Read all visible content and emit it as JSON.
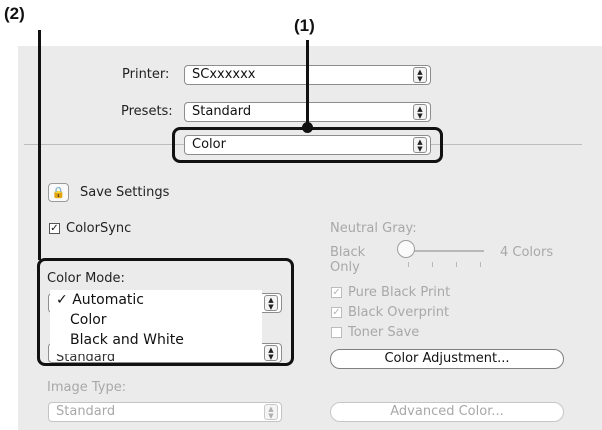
{
  "callouts": {
    "one": "(1)",
    "two": "(2)"
  },
  "printer": {
    "label": "Printer:",
    "value": "SCxxxxxx"
  },
  "presets": {
    "label": "Presets:",
    "value": "Standard"
  },
  "panel_select": {
    "value": "Color"
  },
  "save_settings": {
    "label": "Save Settings"
  },
  "colorsync": {
    "label": "ColorSync",
    "checked": true
  },
  "color_mode": {
    "label": "Color Mode:",
    "menu": [
      {
        "check": "✓",
        "label": "Automatic"
      },
      {
        "check": "",
        "label": "Color"
      },
      {
        "check": "",
        "label": "Black and White"
      }
    ]
  },
  "partial_popup": {
    "value": "Standard"
  },
  "image_type": {
    "label": "Image Type:",
    "value": "Standard"
  },
  "neutral_gray": {
    "label": "Neutral Gray:",
    "left_label_line1": "Black",
    "left_label_line2": "Only",
    "right_label": "4 Colors",
    "level": 0
  },
  "options": {
    "pure_black": {
      "label": "Pure Black Print",
      "checked": true
    },
    "black_overprint": {
      "label": "Black Overprint",
      "checked": true
    },
    "toner_save": {
      "label": "Toner Save",
      "checked": false
    }
  },
  "color_adjustment": {
    "label": "Color Adjustment..."
  },
  "advanced_color": {
    "label": "Advanced Color..."
  },
  "icons": {
    "stepper": "▲▼",
    "check": "✓",
    "lock": "lock-icon"
  }
}
